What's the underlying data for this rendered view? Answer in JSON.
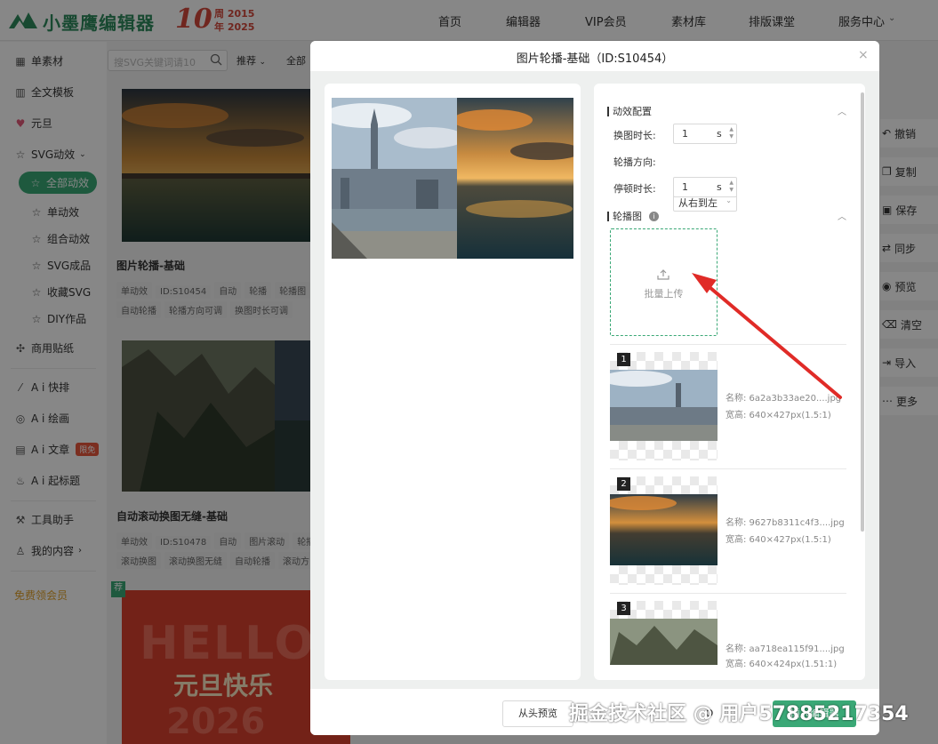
{
  "brand": {
    "name": "小墨鹰编辑器",
    "anniv_num": "10",
    "anniv_line1": "周 2015",
    "anniv_line2": "年 2025",
    "accent": "#3aa876",
    "anniv_color": "#d4483b"
  },
  "nav": [
    {
      "label": "首页"
    },
    {
      "label": "编辑器"
    },
    {
      "label": "VIP会员"
    },
    {
      "label": "素材库"
    },
    {
      "label": "排版课堂"
    },
    {
      "label": "服务中心"
    }
  ],
  "sidebar": {
    "items": [
      {
        "label": "单素材",
        "icon": "grid-icon"
      },
      {
        "label": "全文模板",
        "icon": "template-icon"
      },
      {
        "label": "元旦",
        "icon": "heart-icon"
      },
      {
        "label": "SVG动效",
        "icon": "star-icon"
      },
      {
        "label": "全部动效",
        "icon": "star-icon"
      },
      {
        "label": "单动效",
        "icon": "star-icon"
      },
      {
        "label": "组合动效",
        "icon": "star-icon"
      },
      {
        "label": "SVG成品",
        "icon": "star-icon"
      },
      {
        "label": "收藏SVG",
        "icon": "star-icon"
      },
      {
        "label": "DIY作品",
        "icon": "star-icon"
      },
      {
        "label": "商用贴纸",
        "icon": "puzzle-icon"
      },
      {
        "label": "A i 快排",
        "icon": "ai-icon"
      },
      {
        "label": "A i 绘画",
        "icon": "palette-icon"
      },
      {
        "label": "A i 文章",
        "icon": "doc-icon",
        "badge": "限免"
      },
      {
        "label": "A i 起标题",
        "icon": "flame-icon"
      },
      {
        "label": "工具助手",
        "icon": "tool-icon"
      },
      {
        "label": "我的内容",
        "icon": "user-icon"
      }
    ],
    "free_vip": "免费领会员"
  },
  "listing": {
    "search_placeholder": "搜SVG关键词请10",
    "sort_label": "推荐",
    "filter_all": "全部",
    "cards": [
      {
        "title": "图片轮播-基础",
        "tags_row1": [
          "单动效",
          "ID:S10454",
          "自动",
          "轮播",
          "轮播图"
        ],
        "tags_row2": [
          "自动轮播",
          "轮播方向可调",
          "换图时长可调"
        ]
      },
      {
        "title": "自动滚动换图无缝-基础",
        "tags_row1": [
          "单动效",
          "ID:S10478",
          "自动",
          "图片滚动",
          "轮播"
        ],
        "tags_row2": [
          "滚动换图",
          "滚动换图无缝",
          "自动轮播",
          "滚动方"
        ]
      }
    ],
    "red_card": {
      "hello": "HELLO",
      "title": "元旦快乐",
      "year": "2026"
    },
    "flag": "荐"
  },
  "tools": [
    {
      "label": "撤销",
      "icon": "undo-icon"
    },
    {
      "label": "复制",
      "icon": "copy-icon"
    },
    {
      "label": "保存",
      "icon": "save-icon"
    },
    {
      "label": "同步",
      "icon": "sync-icon"
    },
    {
      "label": "预览",
      "icon": "eye-icon"
    },
    {
      "label": "清空",
      "icon": "trash-icon"
    },
    {
      "label": "导入",
      "icon": "import-icon"
    },
    {
      "label": "更多",
      "icon": "more-icon"
    }
  ],
  "modal": {
    "title": "图片轮播-基础（ID:S10454）",
    "close": "×",
    "config": {
      "section_title": "动效配置",
      "fields": [
        {
          "label": "换图时长:",
          "value": "1",
          "unit": "s"
        },
        {
          "label": "轮播方向:",
          "value": "从右到左"
        },
        {
          "label": "停顿时长:",
          "value": "1",
          "unit": "s"
        }
      ]
    },
    "carousel": {
      "section_title": "轮播图",
      "upload_label": "批量上传",
      "images": [
        {
          "index": "1",
          "name": "名称:  6a2a3b33ae20....jpg",
          "size": "宽高:  640×427px(1.5:1)"
        },
        {
          "index": "2",
          "name": "名称:  9627b8311c4f3....jpg",
          "size": "宽高:  640×427px(1.5:1)"
        },
        {
          "index": "3",
          "name": "名称:  aa718ea115f91....jpg",
          "size": "宽高:  640×424px(1.51:1)"
        }
      ]
    },
    "footer": {
      "replay": "从头预览",
      "second": "O",
      "insert": "插入编辑器"
    }
  },
  "watermark": "掘金技术社区 @ 用户57885217354",
  "annotation": {
    "arrow_color": "#e02b27"
  }
}
